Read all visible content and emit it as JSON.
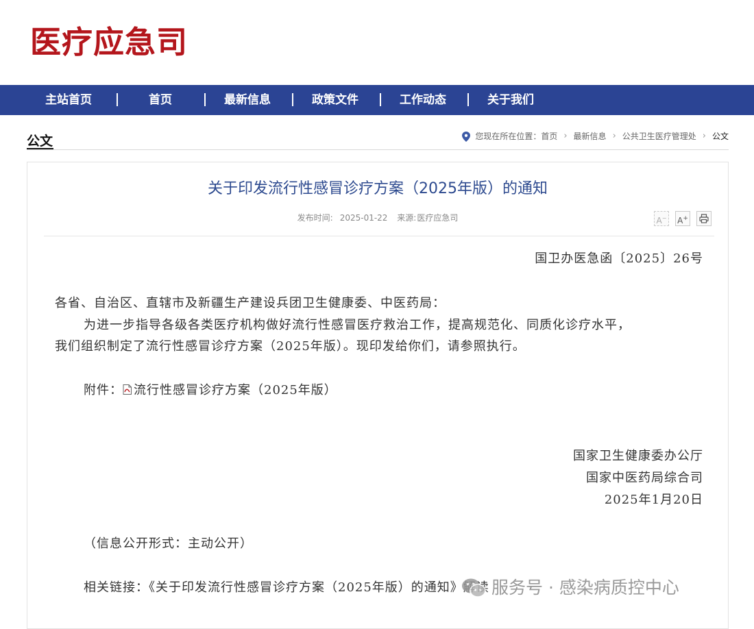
{
  "site": {
    "logo_text": "医疗应急司"
  },
  "nav": {
    "items": [
      "主站首页",
      "首页",
      "最新信息",
      "政策文件",
      "工作动态",
      "关于我们"
    ]
  },
  "section": {
    "title": "公文"
  },
  "breadcrumb": {
    "prefix": "您现在所在位置：",
    "items": [
      "首页",
      "最新信息",
      "公共卫生医疗管理处",
      "公文"
    ]
  },
  "article": {
    "title": "关于印发流行性感冒诊疗方案（2025年版）的通知",
    "publish_label": "发布时间:",
    "publish_date": "2025-01-22",
    "source_label": "来源:",
    "source": "医疗应急司",
    "tools": {
      "font_down": "A",
      "font_up": "A",
      "print": "print"
    },
    "doc_number": "国卫办医急函〔2025〕26号",
    "salutation": "各省、自治区、直辖市及新疆生产建设兵团卫生健康委、中医药局：",
    "body_line1": "为进一步指导各级各类医疗机构做好流行性感冒医疗救治工作，提高规范化、同质化诊疗水平，",
    "body_line2": "我们组织制定了流行性感冒诊疗方案（2025年版）。现印发给你们，请参照执行。",
    "attachment_label": "附件：",
    "attachment_link": "流行性感冒诊疗方案（2025年版）",
    "signature_1": "国家卫生健康委办公厅",
    "signature_2": "国家中医药局综合司",
    "signature_date": "2025年1月20日",
    "disclosure": "（信息公开形式：主动公开）",
    "related_label": "相关链接：",
    "related_link": "《关于印发流行性感冒诊疗方案（2025年版）的通知》解读"
  },
  "watermark": {
    "text": "服务号 · 感染病质控中心"
  },
  "colors": {
    "logo": "#b4161c",
    "nav_bg": "#2b4494",
    "title": "#2d4a8f"
  },
  "icons": [
    "location-pin-icon",
    "chevron-right-icon",
    "font-decrease-icon",
    "font-increase-icon",
    "print-icon",
    "pdf-file-icon",
    "wechat-icon"
  ]
}
